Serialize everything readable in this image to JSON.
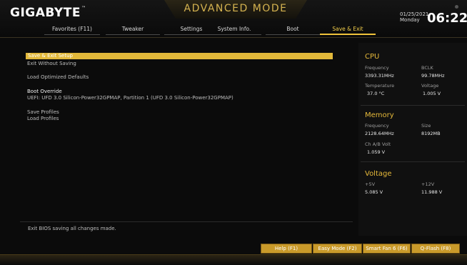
{
  "brand": {
    "name": "GIGABYTE",
    "tm": "™"
  },
  "mode_title": "ADVANCED MODE",
  "clock": {
    "date": "01/25/2021",
    "day": "Monday",
    "time": "06:22"
  },
  "tabs": [
    {
      "label": "Favorites (F11)",
      "active": false
    },
    {
      "label": "Tweaker",
      "active": false
    },
    {
      "label": "Settings",
      "active": false
    },
    {
      "label": "System Info.",
      "active": false
    },
    {
      "label": "Boot",
      "active": false
    },
    {
      "label": "Save & Exit",
      "active": true
    }
  ],
  "menu": {
    "save_exit_setup": "Save & Exit Setup",
    "exit_without_saving": "Exit Without Saving",
    "load_optimized_defaults": "Load Optimized Defaults",
    "boot_override_title": "Boot Override",
    "boot_override_entry": "UEFI: UFD 3.0 Silicon-Power32GPMAP, Partition 1 (UFD 3.0 Silicon-Power32GPMAP)",
    "save_profiles": "Save Profiles",
    "load_profiles": "Load Profiles"
  },
  "help_text": "Exit BIOS saving all changes made.",
  "cpu": {
    "title": "CPU",
    "frequency_label": "Frequency",
    "frequency_value": "3393.31MHz",
    "bclk_label": "BCLK",
    "bclk_value": "99.78MHz",
    "temperature_label": "Temperature",
    "temperature_value": "37.0 °C",
    "voltage_label": "Voltage",
    "voltage_value": "1.005 V"
  },
  "memory": {
    "title": "Memory",
    "frequency_label": "Frequency",
    "frequency_value": "2128.64MHz",
    "size_label": "Size",
    "size_value": "8192MB",
    "chab_label": "Ch A/B Volt",
    "chab_value": "1.059 V"
  },
  "voltage": {
    "title": "Voltage",
    "v5_label": "+5V",
    "v5_value": "5.085 V",
    "v12_label": "+12V",
    "v12_value": "11.988 V"
  },
  "footer_buttons": {
    "help": "Help (F1)",
    "easy_mode": "Easy Mode (F2)",
    "smart_fan": "Smart Fan 6 (F6)",
    "qflash": "Q-Flash (F8)"
  },
  "colors": {
    "accent": "#e2b83a",
    "background": "#0b0b0b"
  }
}
